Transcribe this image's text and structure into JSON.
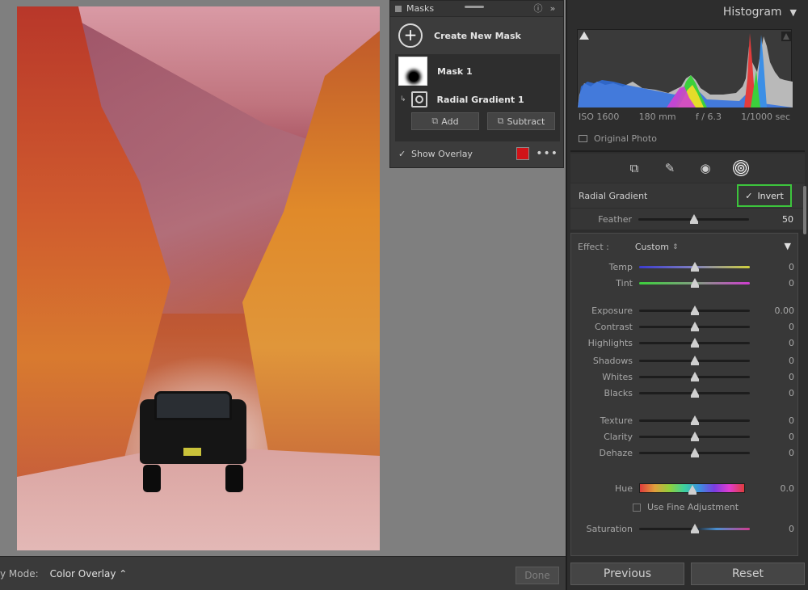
{
  "masks_panel": {
    "title": "Masks",
    "create_label": "Create New Mask",
    "mask_name": "Mask 1",
    "component_name": "Radial Gradient 1",
    "add_label": "Add",
    "subtract_label": "Subtract",
    "overlay_label": "Show Overlay",
    "overlay_color": "#d01318"
  },
  "toolbar": {
    "mode_label": "y Mode:",
    "mode_value": "Color Overlay ⌃",
    "done_label": "Done"
  },
  "histogram": {
    "title": "Histogram",
    "iso": "ISO 1600",
    "focal": "180 mm",
    "aperture": "f / 6.3",
    "shutter": "1/1000 sec",
    "original_photo": "Original Photo"
  },
  "mask_settings": {
    "tool_label": "Radial Gradient",
    "invert_label": "Invert",
    "feather": {
      "label": "Feather",
      "value": "50",
      "level": 0.5
    }
  },
  "effect": {
    "label": "Effect :",
    "preset": "Custom",
    "sliders": [
      {
        "label": "Temp",
        "value": "0"
      },
      {
        "label": "Tint",
        "value": "0"
      },
      {
        "label": "Exposure",
        "value": "0.00"
      },
      {
        "label": "Contrast",
        "value": "0"
      },
      {
        "label": "Highlights",
        "value": "0"
      },
      {
        "label": "Shadows",
        "value": "0"
      },
      {
        "label": "Whites",
        "value": "0"
      },
      {
        "label": "Blacks",
        "value": "0"
      },
      {
        "label": "Texture",
        "value": "0"
      },
      {
        "label": "Clarity",
        "value": "0"
      },
      {
        "label": "Dehaze",
        "value": "0"
      }
    ],
    "hue": {
      "label": "Hue",
      "value": "0.0"
    },
    "fine_adjust": "Use Fine Adjustment",
    "saturation": {
      "label": "Saturation",
      "value": "0"
    }
  },
  "nav": {
    "previous": "Previous",
    "reset": "Reset"
  },
  "colors": {
    "accent_green": "#3cc43c",
    "overlay_red": "#d01318"
  }
}
